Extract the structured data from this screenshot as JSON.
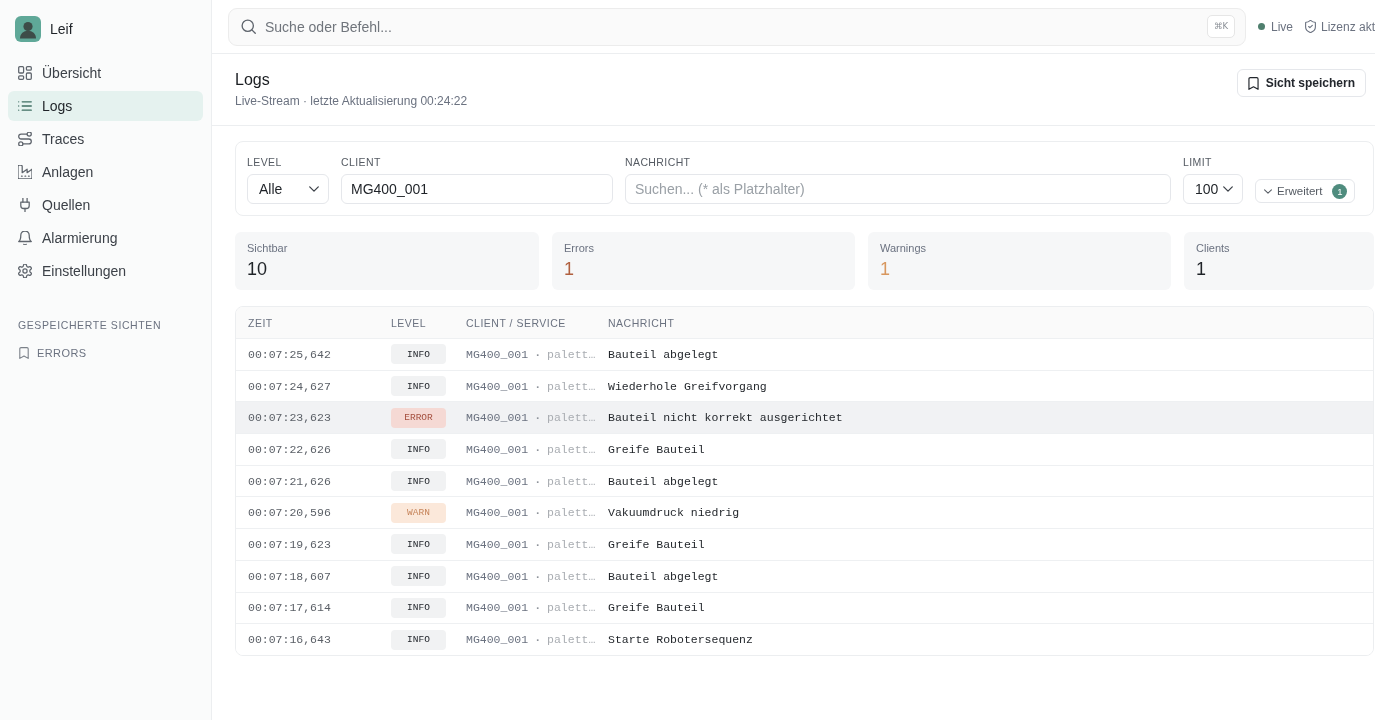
{
  "sidebar": {
    "brand": {
      "name": "Leif"
    },
    "items": [
      {
        "label": "Übersicht",
        "selected": false
      },
      {
        "label": "Logs",
        "selected": true
      },
      {
        "label": "Traces",
        "selected": false
      },
      {
        "label": "Anlagen",
        "selected": false
      },
      {
        "label": "Quellen",
        "selected": false
      },
      {
        "label": "Alarmierung",
        "selected": false
      },
      {
        "label": "Einstellungen",
        "selected": false
      }
    ],
    "saved_views": {
      "title": "GESPEICHERTE SICHTEN",
      "items": [
        {
          "label": "ERRORS"
        }
      ]
    }
  },
  "topbar": {
    "search": {
      "placeholder": "Suche oder Befehl...",
      "shortcut": "⌘K"
    },
    "live": "Live",
    "license": "Lizenz akt"
  },
  "header": {
    "title": "Logs",
    "subtitle": "Live-Stream · letzte Aktualisierung 00:24:22",
    "save_button": "Sicht speichern"
  },
  "filters": {
    "level": {
      "label": "LEVEL",
      "value": "Alle"
    },
    "client": {
      "label": "CLIENT",
      "value": "MG400_001"
    },
    "message": {
      "label": "NACHRICHT",
      "placeholder": "Suchen... (* als Platzhalter)"
    },
    "limit": {
      "label": "LIMIT",
      "value": "100"
    },
    "advanced": {
      "label": "Erweitert",
      "count": "1"
    }
  },
  "stats": [
    {
      "label": "Sichtbar",
      "value": "10",
      "color": "#1f2328"
    },
    {
      "label": "Errors",
      "value": "1",
      "color": "#b0603f"
    },
    {
      "label": "Warnings",
      "value": "1",
      "color": "#d8975e"
    },
    {
      "label": "Clients",
      "value": "1",
      "color": "#1f2328"
    }
  ],
  "table": {
    "columns": [
      "ZEIT",
      "LEVEL",
      "CLIENT / SERVICE",
      "NACHRICHT"
    ],
    "rows": [
      {
        "time": "00:07:25,642",
        "kind": "info",
        "level": "INFO",
        "client": "MG400_001",
        "separator": "·",
        "service": "palett…",
        "message": "Bauteil abgelegt",
        "selected": false
      },
      {
        "time": "00:07:24,627",
        "kind": "info",
        "level": "INFO",
        "client": "MG400_001",
        "separator": "·",
        "service": "palett…",
        "message": "Wiederhole Greifvorgang",
        "selected": false
      },
      {
        "time": "00:07:23,623",
        "kind": "error",
        "level": "ERROR",
        "client": "MG400_001",
        "separator": "·",
        "service": "palett…",
        "message": "Bauteil nicht korrekt ausgerichtet",
        "selected": true
      },
      {
        "time": "00:07:22,626",
        "kind": "info",
        "level": "INFO",
        "client": "MG400_001",
        "separator": "·",
        "service": "palett…",
        "message": "Greife Bauteil",
        "selected": false
      },
      {
        "time": "00:07:21,626",
        "kind": "info",
        "level": "INFO",
        "client": "MG400_001",
        "separator": "·",
        "service": "palett…",
        "message": "Bauteil abgelegt",
        "selected": false
      },
      {
        "time": "00:07:20,596",
        "kind": "warn",
        "level": "WARN",
        "client": "MG400_001",
        "separator": "·",
        "service": "palett…",
        "message": "Vakuumdruck niedrig",
        "selected": false
      },
      {
        "time": "00:07:19,623",
        "kind": "info",
        "level": "INFO",
        "client": "MG400_001",
        "separator": "·",
        "service": "palett…",
        "message": "Greife Bauteil",
        "selected": false
      },
      {
        "time": "00:07:18,607",
        "kind": "info",
        "level": "INFO",
        "client": "MG400_001",
        "separator": "·",
        "service": "palett…",
        "message": "Bauteil abgelegt",
        "selected": false
      },
      {
        "time": "00:07:17,614",
        "kind": "info",
        "level": "INFO",
        "client": "MG400_001",
        "separator": "·",
        "service": "palett…",
        "message": "Greife Bauteil",
        "selected": false
      },
      {
        "time": "00:07:16,643",
        "kind": "info",
        "level": "INFO",
        "client": "MG400_001",
        "separator": "·",
        "service": "palett…",
        "message": "Starte Robotersequenz",
        "selected": false
      }
    ]
  }
}
